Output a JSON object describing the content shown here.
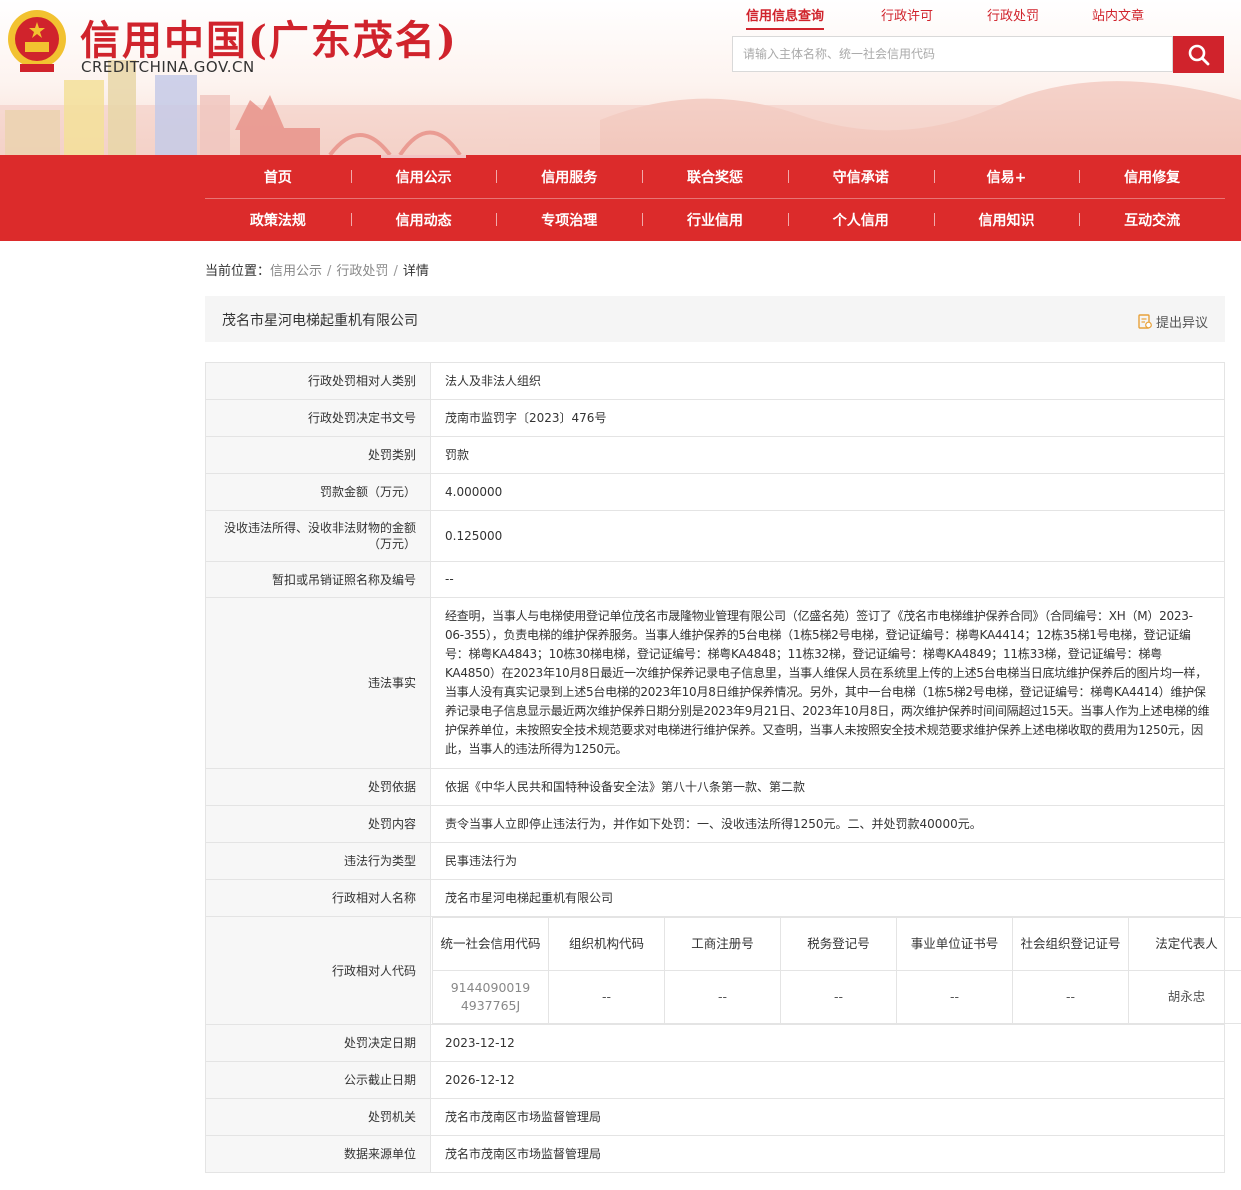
{
  "header": {
    "logo_title": "信用中国(广东茂名)",
    "logo_sub": "CREDITCHINA.GOV.CN",
    "top_links": [
      "信用信息查询",
      "行政许可",
      "行政处罚",
      "站内文章"
    ],
    "search_placeholder": "请输入主体名称、统一社会信用代码"
  },
  "nav": {
    "row1": [
      "首页",
      "信用公示",
      "信用服务",
      "联合奖惩",
      "守信承诺",
      "信易+",
      "信用修复"
    ],
    "row2": [
      "政策法规",
      "信用动态",
      "专项治理",
      "行业信用",
      "个人信用",
      "信用知识",
      "互动交流"
    ],
    "active": "信用公示"
  },
  "breadcrumb": {
    "prefix": "当前位置：",
    "items": [
      "信用公示",
      "行政处罚",
      "详情"
    ]
  },
  "title_bar": {
    "company": "茂名市星河电梯起重机有限公司",
    "objection_label": "提出异议"
  },
  "detail_rows": [
    {
      "label": "行政处罚相对人类别",
      "value": "法人及非法人组织"
    },
    {
      "label": "行政处罚决定书文号",
      "value": "茂南市监罚字〔2023〕476号"
    },
    {
      "label": "处罚类别",
      "value": "罚款"
    },
    {
      "label": "罚款金额（万元）",
      "value": "4.000000"
    },
    {
      "label": "没收违法所得、没收非法财物的金额（万元）",
      "value": "0.125000"
    },
    {
      "label": "暂扣或吊销证照名称及编号",
      "value": "--"
    },
    {
      "label": "违法事实",
      "value": "经查明，当事人与电梯使用登记单位茂名市晟隆物业管理有限公司（亿盛名苑）签订了《茂名市电梯维护保养合同》（合同编号：XH（M）2023-06-355），负责电梯的维护保养服务。当事人维护保养的5台电梯（1栋5梯2号电梯，登记证编号：梯粤KA4414；12栋35梯1号电梯，登记证编号：梯粤KA4843；10栋30梯电梯，登记证编号：梯粤KA4848；11栋32梯，登记证编号：梯粤KA4849；11栋33梯，登记证编号：梯粤KA4850）在2023年10月8日最近一次维护保养记录电子信息里，当事人维保人员在系统里上传的上述5台电梯当日底坑维护保养后的图片均一样，当事人没有真实记录到上述5台电梯的2023年10月8日维护保养情况。另外，其中一台电梯（1栋5梯2号电梯，登记证编号：梯粤KA4414）维护保养记录电子信息显示最近两次维护保养日期分别是2023年9月21日、2023年10月8日，两次维护保养时间间隔超过15天。当事人作为上述电梯的维护保养单位，未按照安全技术规范要求对电梯进行维护保养。又查明，当事人未按照安全技术规范要求维护保养上述电梯收取的费用为1250元，因此，当事人的违法所得为1250元。"
    },
    {
      "label": "处罚依据",
      "value": "依据《中华人民共和国特种设备安全法》第八十八条第一款、第二款"
    },
    {
      "label": "处罚内容",
      "value": "责令当事人立即停止违法行为，并作如下处罚：一、没收违法所得1250元。二、并处罚款40000元。"
    },
    {
      "label": "违法行为类型",
      "value": "民事违法行为"
    },
    {
      "label": "行政相对人名称",
      "value": "茂名市星河电梯起重机有限公司"
    }
  ],
  "code_row": {
    "label": "行政相对人代码",
    "headers": [
      "统一社会信用代码",
      "组织机构代码",
      "工商注册号",
      "税务登记号",
      "事业单位证书号",
      "社会组织登记证号",
      "法定代表人"
    ],
    "values": [
      "91440900194937765J",
      "--",
      "--",
      "--",
      "--",
      "--",
      "胡永忠"
    ]
  },
  "detail_rows_after": [
    {
      "label": "处罚决定日期",
      "value": "2023-12-12"
    },
    {
      "label": "公示截止日期",
      "value": "2026-12-12"
    },
    {
      "label": "处罚机关",
      "value": "茂名市茂南区市场监督管理局"
    },
    {
      "label": "数据来源单位",
      "value": "茂名市茂南区市场监督管理局"
    }
  ],
  "colors": {
    "brand_red": "#dc2b2b",
    "logo_red": "#d0232c",
    "emblem_gold": "#f2c230"
  },
  "icons": [
    "national-emblem-icon",
    "search-icon",
    "objection-icon"
  ]
}
